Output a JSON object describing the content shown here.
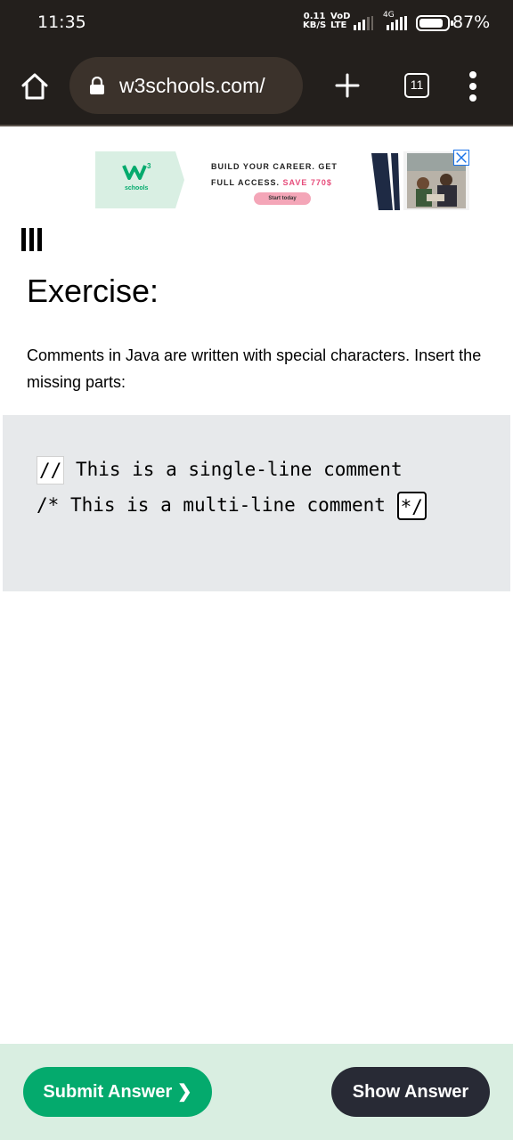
{
  "status_bar": {
    "time": "11:35",
    "speed_value": "0.11",
    "speed_unit": "KB/S",
    "volte_top": "VoD",
    "volte_bottom": "LTE",
    "network": "4G",
    "battery_percent": "87%",
    "battery_level": 0.87
  },
  "browser": {
    "url": "w3schools.com/",
    "tab_count": "11",
    "icons": [
      "home-icon",
      "lock-icon",
      "plus-icon",
      "tabs-icon",
      "more-vert-icon"
    ]
  },
  "ad": {
    "brand": "schools",
    "headline_line1": "BUILD YOUR CAREER. GET",
    "headline_line2": "FULL ACCESS.",
    "headline_highlight": "SAVE 770$",
    "cta": "Start today",
    "accent_color": "#e64b7a"
  },
  "exercise": {
    "title": "Exercise:",
    "description": "Comments in Java are written with special characters. Insert the missing parts:",
    "code": {
      "line1_input": "//",
      "line1_text": " This is a single-line comment",
      "line2_prefix": "/* ",
      "line2_text": "This is a multi-line comment ",
      "line2_input": "*/"
    }
  },
  "actions": {
    "submit_label": "Submit Answer ❯",
    "show_label": "Show Answer",
    "submit_color": "#04aa6d",
    "show_color": "#282a35"
  }
}
